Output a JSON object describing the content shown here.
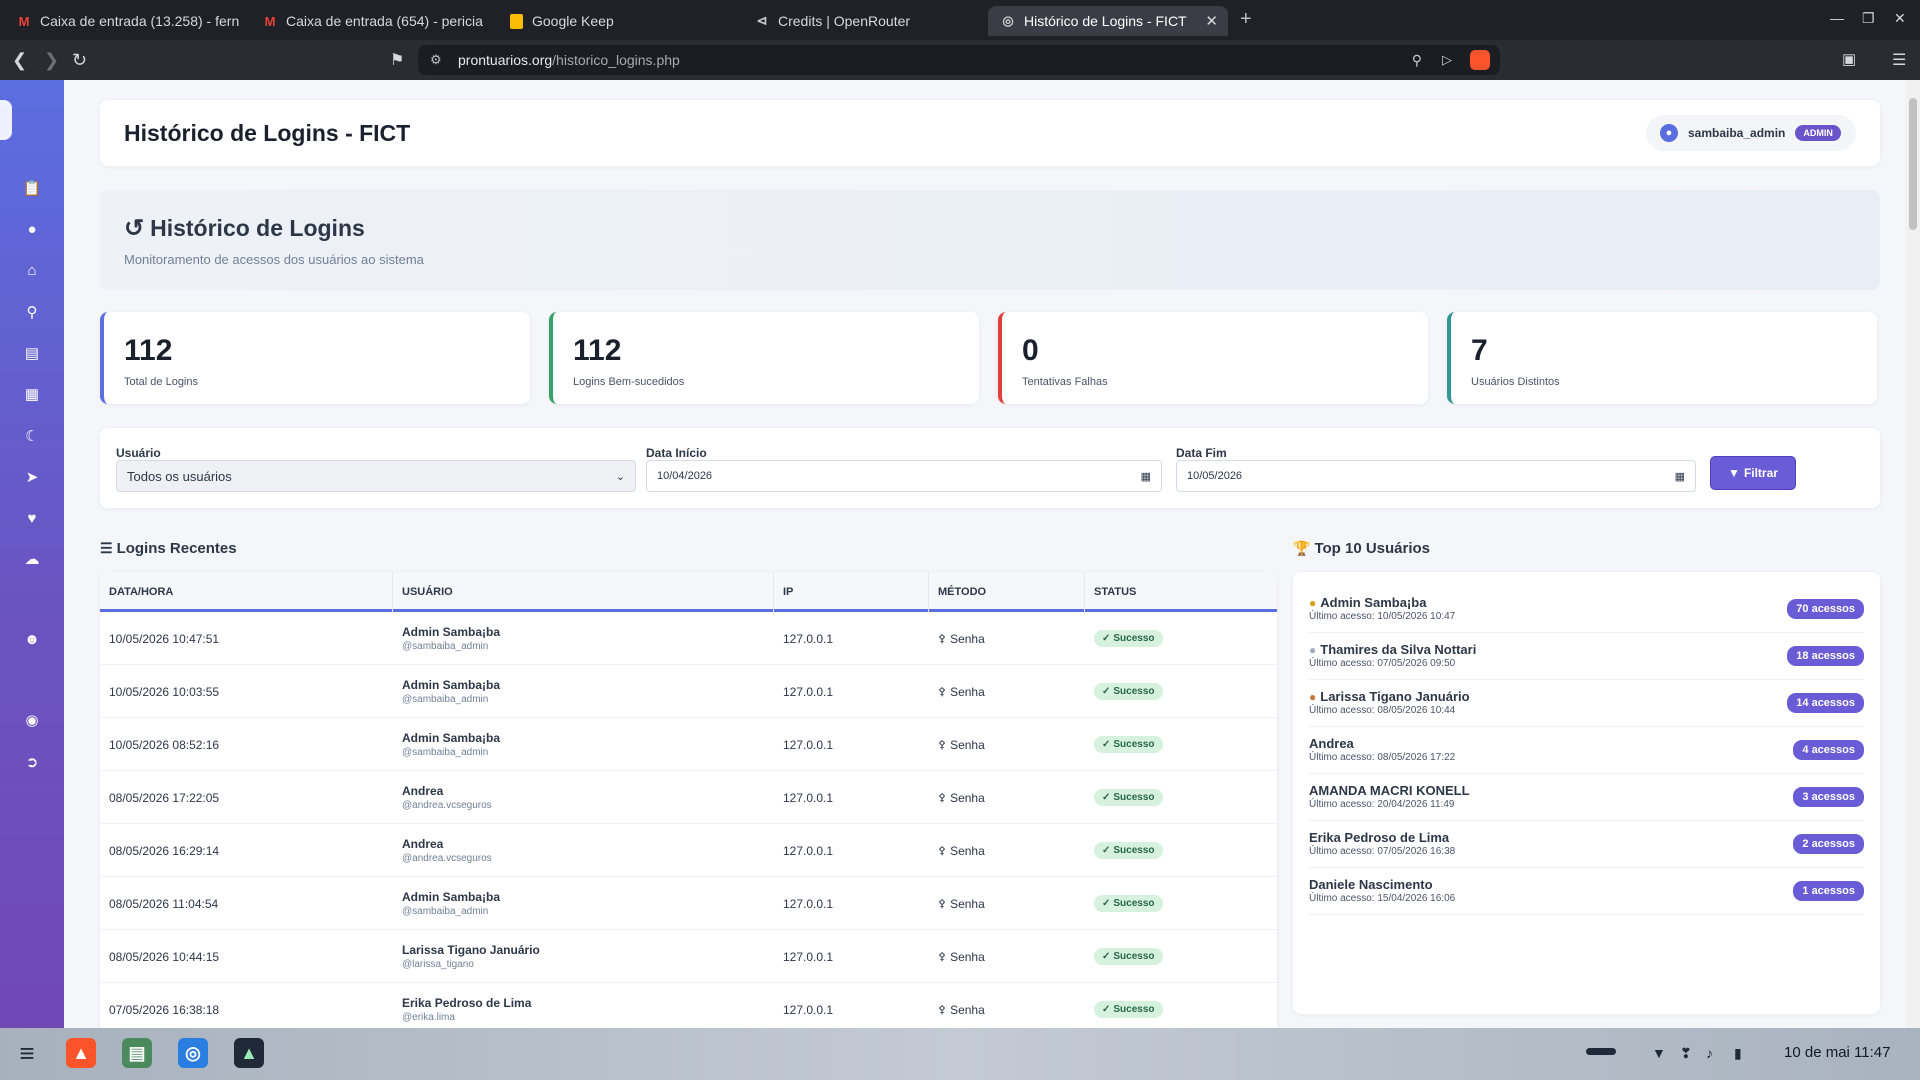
{
  "browser": {
    "tabs": [
      {
        "label": "Caixa de entrada (13.258) - fern",
        "icon": "gmail-icon"
      },
      {
        "label": "Caixa de entrada (654) - pericia",
        "icon": "gmail-icon"
      },
      {
        "label": "Google Keep",
        "icon": "keep-icon"
      },
      {
        "label": "Credits | OpenRouter",
        "icon": "openrouter-icon"
      },
      {
        "label": "Histórico de Logins - FICT",
        "icon": "globe-icon",
        "active": true
      }
    ],
    "url_host": "prontuarios.org",
    "url_path": "/historico_logins.php"
  },
  "page": {
    "title": "Histórico de Logins - FICT",
    "user": {
      "name": "sambaiba_admin",
      "role": "ADMIN"
    }
  },
  "hero": {
    "title": "Histórico de Logins",
    "subtitle": "Monitoramento de acessos dos usuários ao sistema"
  },
  "stats": [
    {
      "value": "112",
      "label": "Total de Logins",
      "color": "#5b6ee0"
    },
    {
      "value": "112",
      "label": "Logins Bem-sucedidos",
      "color": "#38a169"
    },
    {
      "value": "0",
      "label": "Tentativas Falhas",
      "color": "#e53e3e"
    },
    {
      "value": "7",
      "label": "Usuários Distintos",
      "color": "#319795"
    }
  ],
  "filters": {
    "user_label": "Usuário",
    "user_value": "Todos os usuários",
    "start_label": "Data Início",
    "start_value": "10/04/2026",
    "end_label": "Data Fim",
    "end_value": "10/05/2026",
    "button": "Filtrar"
  },
  "recent": {
    "title": "Logins Recentes",
    "columns": [
      "DATA/HORA",
      "USUÁRIO",
      "IP",
      "MÉTODO",
      "STATUS"
    ],
    "rows": [
      {
        "datetime": "10/05/2026 10:47:51",
        "name": "Admin Samba¡ba",
        "handle": "@sambaiba_admin",
        "ip": "127.0.0.1",
        "method": "Senha",
        "status": "Sucesso"
      },
      {
        "datetime": "10/05/2026 10:03:55",
        "name": "Admin Samba¡ba",
        "handle": "@sambaiba_admin",
        "ip": "127.0.0.1",
        "method": "Senha",
        "status": "Sucesso"
      },
      {
        "datetime": "10/05/2026 08:52:16",
        "name": "Admin Samba¡ba",
        "handle": "@sambaiba_admin",
        "ip": "127.0.0.1",
        "method": "Senha",
        "status": "Sucesso"
      },
      {
        "datetime": "08/05/2026 17:22:05",
        "name": "Andrea",
        "handle": "@andrea.vcseguros",
        "ip": "127.0.0.1",
        "method": "Senha",
        "status": "Sucesso"
      },
      {
        "datetime": "08/05/2026 16:29:14",
        "name": "Andrea",
        "handle": "@andrea.vcseguros",
        "ip": "127.0.0.1",
        "method": "Senha",
        "status": "Sucesso"
      },
      {
        "datetime": "08/05/2026 11:04:54",
        "name": "Admin Samba¡ba",
        "handle": "@sambaiba_admin",
        "ip": "127.0.0.1",
        "method": "Senha",
        "status": "Sucesso"
      },
      {
        "datetime": "08/05/2026 10:44:15",
        "name": "Larissa Tigano Januário",
        "handle": "@larissa_tigano",
        "ip": "127.0.0.1",
        "method": "Senha",
        "status": "Sucesso"
      },
      {
        "datetime": "07/05/2026 16:38:18",
        "name": "Erika Pedroso de Lima",
        "handle": "@erika.lima",
        "ip": "127.0.0.1",
        "method": "Senha",
        "status": "Sucesso"
      }
    ]
  },
  "top10": {
    "title": "Top 10 Usuários",
    "items": [
      {
        "name": "Admin Samba¡ba",
        "last": "Último acesso: 10/05/2026 10:47",
        "count": "70 acessos",
        "medal": "gold"
      },
      {
        "name": "Thamires da Silva Nottari",
        "last": "Último acesso: 07/05/2026 09:50",
        "count": "18 acessos",
        "medal": "silver"
      },
      {
        "name": "Larissa Tigano Januário",
        "last": "Último acesso: 08/05/2026 10:44",
        "count": "14 acessos",
        "medal": "bronze"
      },
      {
        "name": "Andrea",
        "last": "Último acesso: 08/05/2026 17:22",
        "count": "4 acessos",
        "medal": ""
      },
      {
        "name": "AMANDA MACRI KONELL",
        "last": "Último acesso: 20/04/2026 11:49",
        "count": "3 acessos",
        "medal": ""
      },
      {
        "name": "Erika Pedroso de Lima",
        "last": "Último acesso: 07/05/2026 16:38",
        "count": "2 acessos",
        "medal": ""
      },
      {
        "name": "Daniele Nascimento",
        "last": "Último acesso: 15/04/2026 16:06",
        "count": "1 acessos",
        "medal": ""
      }
    ]
  },
  "taskbar": {
    "clock": "10 de mai  11:47"
  }
}
